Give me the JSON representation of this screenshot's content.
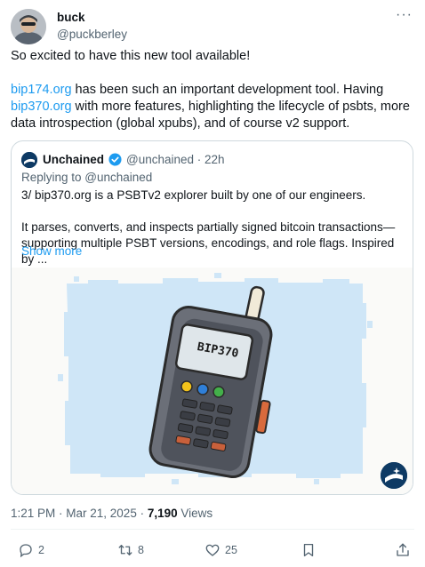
{
  "author": {
    "name": "buck",
    "handle": "@puckberley"
  },
  "tweet": {
    "line1": "So excited to have this new tool available!",
    "link1": "bip174.org",
    "text2a": " has been such an important development tool. Having",
    "link2": "bip370.org",
    "text2b": " with more features, highlighting the lifecycle of psbts, more data introspection (global xpubs), and of course v2 support."
  },
  "quote": {
    "name": "Unchained",
    "handle_time": "@unchained · 22h",
    "replying": "Replying to @unchained",
    "para1": "3/ bip370.org is a PSBTv2 explorer built by one of our engineers.",
    "para2": "It parses, converts, and inspects partially signed bitcoin transactions—supporting multiple PSBT versions, encodings, and role flags. Inspired by ...",
    "show_more": "Show more",
    "device_label": "BIP370"
  },
  "meta": {
    "time_date": "1:21 PM · Mar 21, 2025 · ",
    "views_count": "7,190",
    "views_label": " Views"
  },
  "actions": {
    "replies": "2",
    "reposts": "8",
    "likes": "25"
  },
  "colors": {
    "link": "#1d9bf0",
    "text": "#0f1419",
    "muted": "#536471",
    "border": "#cfd9de"
  }
}
